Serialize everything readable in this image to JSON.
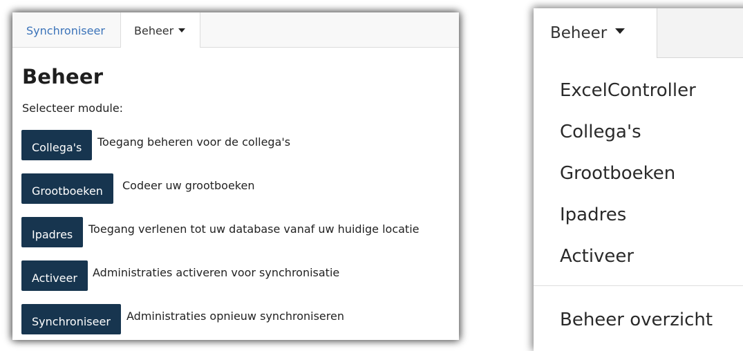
{
  "left": {
    "nav": {
      "tab_sync": "Synchroniseer",
      "tab_beheer": "Beheer"
    },
    "title": "Beheer",
    "subtitle": "Selecteer module:",
    "modules": [
      {
        "button": "Collega's",
        "description": "Toegang beheren voor de collega's"
      },
      {
        "button": "Grootboeken",
        "description": "Codeer uw grootboeken"
      },
      {
        "button": "Ipadres",
        "description": "Toegang verlenen tot uw database vanaf uw huidige locatie"
      },
      {
        "button": "Activeer",
        "description": "Administraties activeren voor synchronisatie"
      },
      {
        "button": "Synchroniseer",
        "description": "Administraties opnieuw synchroniseren"
      }
    ],
    "colors": {
      "button_bg": "#17354f",
      "link": "#3b73b9"
    }
  },
  "right": {
    "tab": "Beheer",
    "menu": [
      "ExcelController",
      "Collega's",
      "Grootboeken",
      "Ipadres",
      "Activeer"
    ],
    "footer_item": "Beheer overzicht"
  }
}
